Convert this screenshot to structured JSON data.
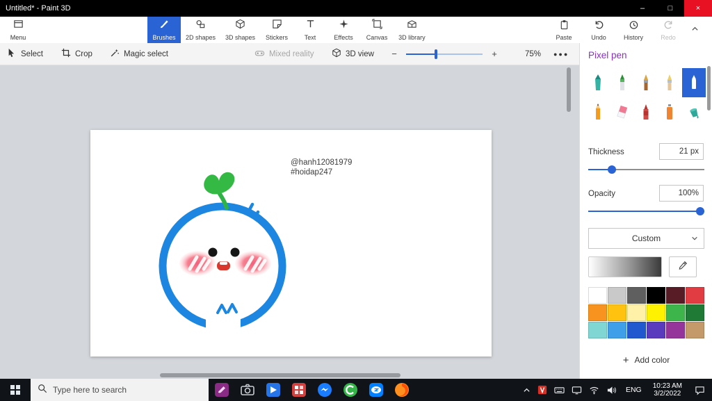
{
  "window": {
    "title": "Untitled* - Paint 3D",
    "minimize": "–",
    "maximize": "□",
    "close": "×"
  },
  "ribbon": {
    "menu_label": "Menu",
    "tabs": [
      {
        "label": "Brushes",
        "selected": true
      },
      {
        "label": "2D shapes"
      },
      {
        "label": "3D shapes"
      },
      {
        "label": "Stickers"
      },
      {
        "label": "Text"
      },
      {
        "label": "Effects"
      },
      {
        "label": "Canvas"
      },
      {
        "label": "3D library"
      }
    ],
    "paste_label": "Paste",
    "undo_label": "Undo",
    "history_label": "History",
    "redo_label": "Redo"
  },
  "toolbar": {
    "select": "Select",
    "crop": "Crop",
    "magic_select": "Magic select",
    "mixed_reality": "Mixed reality",
    "view_3d": "3D view",
    "zoom_out": "−",
    "zoom_in": "+",
    "zoom_level": "75%",
    "more": "●●●"
  },
  "panel": {
    "title": "Pixel pen",
    "brushes": [
      "Marker",
      "Calligraphy pen",
      "Oil brush",
      "Watercolor",
      "Pixel pen",
      "Pencil",
      "Eraser",
      "Crayon",
      "Spray can",
      "Fill"
    ],
    "selected_brush": "Pixel pen",
    "thickness_label": "Thickness",
    "thickness_value": "21 px",
    "opacity_label": "Opacity",
    "opacity_value": "100%",
    "color_mode": "Custom",
    "palette": [
      "#ffffff",
      "#c9c9c9",
      "#5f5f5f",
      "#000000",
      "#571c26",
      "#e03c41",
      "#f7931e",
      "#ffc20e",
      "#fff1a8",
      "#fff200",
      "#3db54a",
      "#1e7a34",
      "#7fd6d2",
      "#3f9fe8",
      "#2158d0",
      "#5b3bbd",
      "#95359b",
      "#c59a6b"
    ],
    "add_color": "Add color"
  },
  "canvas": {
    "text_line1": "@hanh12081979",
    "text_line2": "#hoidap247"
  },
  "taskbar": {
    "search_placeholder": "Type here to search",
    "language": "ENG",
    "time": "10:23 AM",
    "date": "3/2/2022"
  }
}
